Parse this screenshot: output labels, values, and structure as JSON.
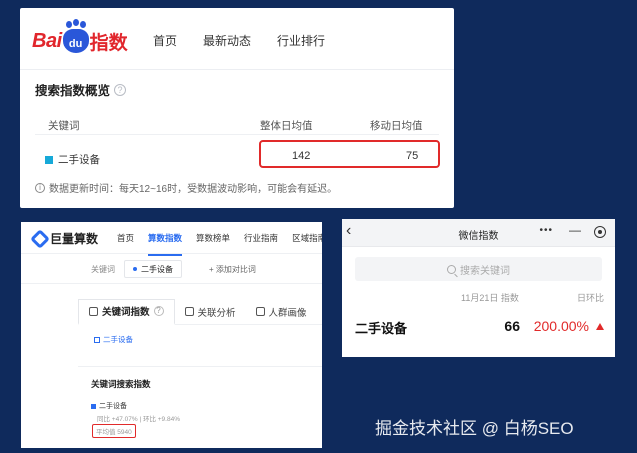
{
  "baidu": {
    "logo_left": "Bai",
    "logo_mid": "du",
    "logo_right": "指数",
    "nav": [
      "首页",
      "最新动态",
      "行业排行"
    ],
    "section_title": "搜索指数概览",
    "help_glyph": "?",
    "col_keyword": "关键词",
    "col_overall": "整体日均值",
    "col_mobile": "移动日均值",
    "keyword": "二手设备",
    "keyword_color": "#16a9d8",
    "overall_value": "142",
    "mobile_value": "75",
    "info_glyph": "i",
    "note": "数据更新时间：每天12~16时，受数据波动影响，可能会有延迟。",
    "highlight_color": "#e12a2a"
  },
  "juliang": {
    "logo": "巨量算数",
    "nav": [
      "首页",
      "算数指数",
      "算数榜单",
      "行业指南",
      "区域指南"
    ],
    "active_nav_index": 1,
    "keyword_label": "关键词",
    "keyword_chip": "二手设备",
    "add_compare": "+ 添加对比词",
    "tabs": [
      "关键词指数",
      "关联分析",
      "人群画像"
    ],
    "tab_help": "?",
    "selected_keyword": "二手设备",
    "card_title": "关键词搜索指数",
    "series_name": "二手设备",
    "ratio_text": "同比 +47.07% | 环比 +9.84%",
    "avg_text": "平均值 5940",
    "accent": "#2a6cf0"
  },
  "wechat": {
    "back_glyph": "‹",
    "title": "微信指数",
    "more_glyph": "•••",
    "min_glyph": "—",
    "search_placeholder": "搜索关键词",
    "date_label": "11月21日 指数",
    "dod_label": "日环比",
    "keyword": "二手设备",
    "value": "66",
    "change": "200.00%",
    "change_color": "#e12a2a"
  },
  "watermark": "掘金技术社区 @ 白杨SEO"
}
